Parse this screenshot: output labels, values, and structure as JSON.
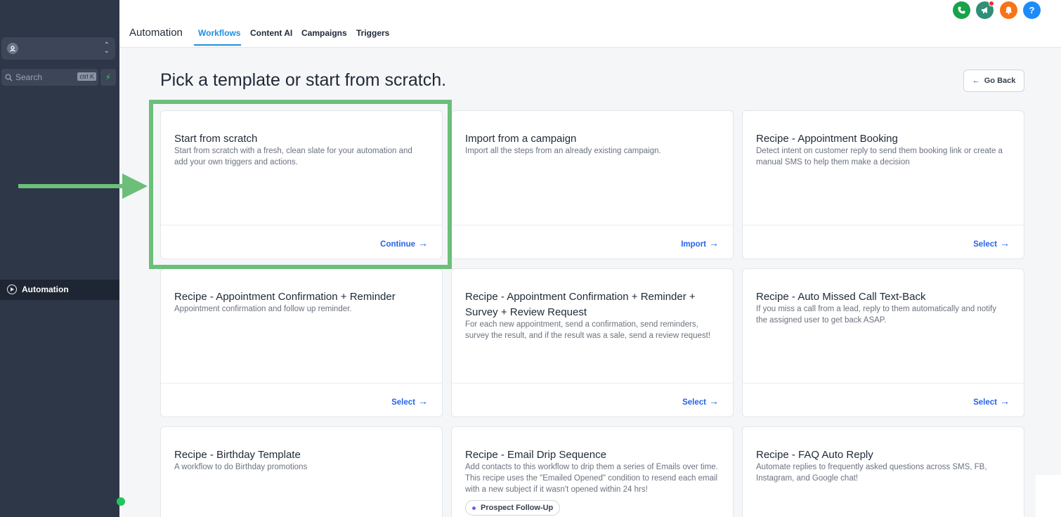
{
  "sidebar": {
    "search_placeholder": "Search",
    "search_shortcut": "ctrl K",
    "active_item": "Automation"
  },
  "header": {
    "title": "Automation",
    "tabs": [
      "Workflows",
      "Content AI",
      "Campaigns",
      "Triggers"
    ],
    "active_tab": "Workflows",
    "help_label": "?"
  },
  "main": {
    "heading": "Pick a template or start from scratch.",
    "go_back_label": "Go Back",
    "cards": [
      {
        "title": "Start from scratch",
        "desc": "Start from scratch with a fresh, clean slate for your automation and add your own triggers and actions.",
        "action": "Continue"
      },
      {
        "title": "Import from a campaign",
        "desc": "Import all the steps from an already existing campaign.",
        "action": "Import"
      },
      {
        "title": "Recipe - Appointment Booking",
        "desc": "Detect intent on customer reply to send them booking link or create a manual SMS to help them make a decision",
        "action": "Select"
      },
      {
        "title": "Recipe - Appointment Confirmation + Reminder",
        "desc": "Appointment confirmation and follow up reminder.",
        "action": "Select"
      },
      {
        "title": "Recipe - Appointment Confirmation + Reminder + Survey + Review Request",
        "desc": "For each new appointment, send a confirmation, send reminders, survey the result, and if the result was a sale, send a review request!",
        "action": "Select"
      },
      {
        "title": "Recipe - Auto Missed Call Text-Back",
        "desc": "If you miss a call from a lead, reply to them automatically and notify the assigned user to get back ASAP.",
        "action": "Select"
      },
      {
        "title": "Recipe - Birthday Template",
        "desc": "A workflow to do Birthday promotions"
      },
      {
        "title": "Recipe - Email Drip Sequence",
        "desc": "Add contacts to this workflow to drip them a series of Emails over time. This recipe uses the \"Emailed Opened\" condition to resend each email with a new subject if it wasn't opened within 24 hrs!",
        "tag": "Prospect Follow-Up"
      },
      {
        "title": "Recipe - FAQ Auto Reply",
        "desc": "Automate replies to frequently asked questions across SMS, FB, Instagram, and Google chat!"
      }
    ]
  },
  "colors": {
    "sidebar_bg": "#2d3748",
    "accent_blue": "#2563eb",
    "tab_active": "#1f8fe0",
    "highlight_green": "#6cbf78",
    "phone_icon": "#16a34a",
    "megaphone_icon": "#2f8f78",
    "bell_icon": "#f97316",
    "help_icon": "#1d8cf8"
  },
  "icons": [
    "location-icon",
    "search-icon",
    "bolt-icon",
    "automation-icon",
    "phone-icon",
    "megaphone-icon",
    "bell-icon",
    "help-icon",
    "arrow-left-icon",
    "arrow-right-icon"
  ]
}
